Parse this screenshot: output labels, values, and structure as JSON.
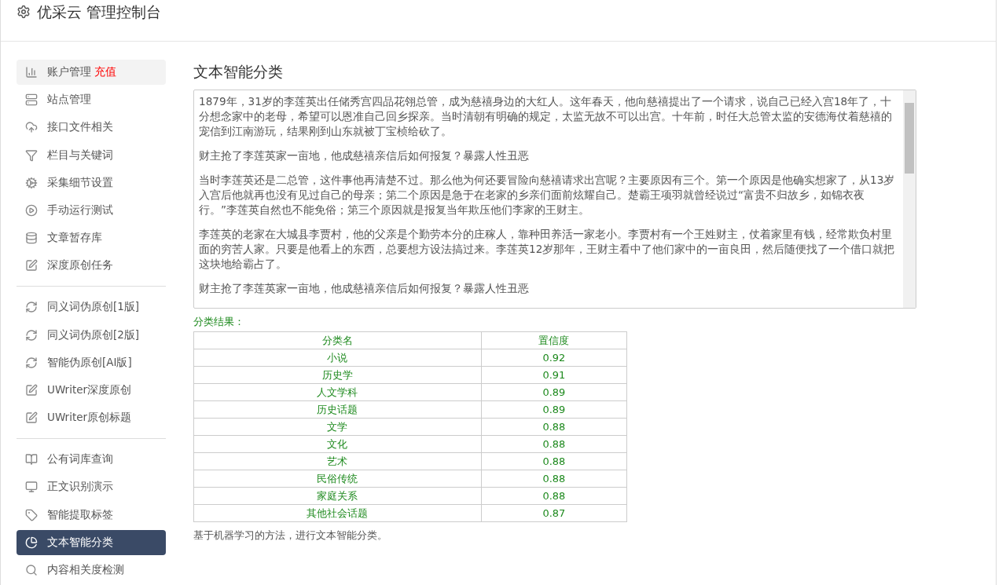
{
  "header": {
    "title": "优采云 管理控制台"
  },
  "sidebar": {
    "groups": [
      {
        "items": [
          {
            "kind": "bar-chart",
            "label": "账户管理",
            "badge": "充值",
            "selected": false,
            "hover": true
          },
          {
            "kind": "server",
            "label": "站点管理",
            "selected": false,
            "hover": false
          },
          {
            "kind": "cloud-upload",
            "label": "接口文件相关",
            "selected": false,
            "hover": false
          },
          {
            "kind": "filter",
            "label": "栏目与关键词",
            "selected": false,
            "hover": false
          },
          {
            "kind": "cogs",
            "label": "采集细节设置",
            "selected": false,
            "hover": false
          },
          {
            "kind": "play",
            "label": "手动运行测试",
            "selected": false,
            "hover": false
          },
          {
            "kind": "database",
            "label": "文章暂存库",
            "selected": false,
            "hover": false
          },
          {
            "kind": "edit",
            "label": "深度原创任务",
            "selected": false,
            "hover": false
          }
        ]
      },
      {
        "items": [
          {
            "kind": "refresh",
            "label": "同义词伪原创[1版]",
            "selected": false,
            "hover": false
          },
          {
            "kind": "refresh",
            "label": "同义词伪原创[2版]",
            "selected": false,
            "hover": false
          },
          {
            "kind": "refresh",
            "label": "智能伪原创[AI版]",
            "selected": false,
            "hover": false
          },
          {
            "kind": "edit",
            "label": "UWriter深度原创",
            "selected": false,
            "hover": false
          },
          {
            "kind": "edit",
            "label": "UWriter原创标题",
            "selected": false,
            "hover": false
          }
        ]
      },
      {
        "items": [
          {
            "kind": "book",
            "label": "公有词库查询",
            "selected": false,
            "hover": false
          },
          {
            "kind": "monitor",
            "label": "正文识别演示",
            "selected": false,
            "hover": false
          },
          {
            "kind": "tag",
            "label": "智能提取标签",
            "selected": false,
            "hover": false
          },
          {
            "kind": "pie",
            "label": "文本智能分类",
            "selected": true,
            "hover": false
          },
          {
            "kind": "search",
            "label": "内容相关度检测",
            "selected": false,
            "hover": false
          }
        ]
      }
    ]
  },
  "main": {
    "title": "文本智能分类",
    "input": {
      "paragraphs": [
        "1879年，31岁的李莲英出任储秀宫四品花翎总管，成为慈禧身边的大红人。这年春天，他向慈禧提出了一个请求，说自己已经入宫18年了，十分想念家中的老母，希望可以恩准自己回乡探亲。当时清朝有明确的规定，太监无故不可以出宫。十年前，时任大总管太监的安德海仗着慈禧的宠信到江南游玩，结果刚到山东就被丁宝桢给砍了。",
        "财主抢了李莲英家一亩地，他成慈禧亲信后如何报复？暴露人性丑恶",
        "当时李莲英还是二总管，这件事他再清楚不过。那么他为何还要冒险向慈禧请求出宫呢？主要原因有三个。第一个原因是他确实想家了，从13岁入宫后他就再也没有见过自己的母亲；第二个原因是急于在老家的乡亲们面前炫耀自己。楚霸王项羽就曾经说过“富贵不归故乡，如锦衣夜行。”李莲英自然也不能免俗；第三个原因就是报复当年欺压他们李家的王财主。",
        "李莲英的老家在大城县李贾村，他的父亲是个勤劳本分的庄稼人，靠种田养活一家老小。李贾村有一个王姓财主，仗着家里有钱，经常欺负村里面的穷苦人家。只要是他看上的东西，总要想方设法搞过来。李莲英12岁那年，王财主看中了他们家中的一亩良田，然后随便找了一个借口就把这块地给霸占了。",
        "财主抢了李莲英家一亩地，他成慈禧亲信后如何报复？暴露人性丑恶"
      ]
    },
    "result_label": "分类结果：",
    "table": {
      "columns": [
        "分类名",
        "置信度"
      ],
      "rows": [
        [
          "小说",
          "0.92"
        ],
        [
          "历史学",
          "0.91"
        ],
        [
          "人文学科",
          "0.89"
        ],
        [
          "历史话题",
          "0.89"
        ],
        [
          "文学",
          "0.88"
        ],
        [
          "文化",
          "0.88"
        ],
        [
          "艺术",
          "0.88"
        ],
        [
          "民俗传统",
          "0.88"
        ],
        [
          "家庭关系",
          "0.88"
        ],
        [
          "其他社会话题",
          "0.87"
        ]
      ]
    },
    "note": "基于机器学习的方法，进行文本智能分类。"
  }
}
